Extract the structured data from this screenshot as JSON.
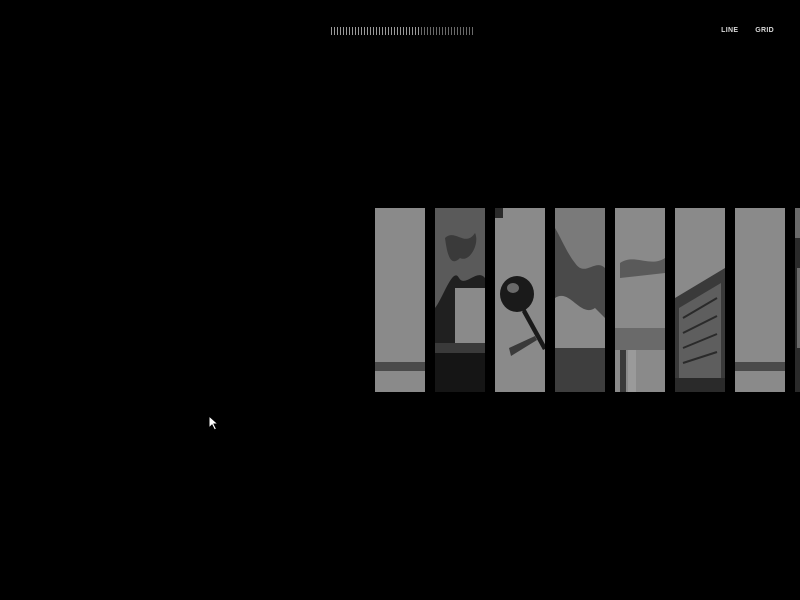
{
  "header": {
    "scrubber_progress": 0.62,
    "view_modes": [
      {
        "label": "LINE"
      },
      {
        "label": "GRID"
      }
    ]
  },
  "gallery": {
    "slices": [
      {
        "icon": "image-thumbnail-plain"
      },
      {
        "icon": "image-thumbnail-foliage"
      },
      {
        "icon": "image-thumbnail-spoon"
      },
      {
        "icon": "image-thumbnail-abstract"
      },
      {
        "icon": "image-thumbnail-sky"
      },
      {
        "icon": "image-thumbnail-building"
      },
      {
        "icon": "image-thumbnail-plain"
      },
      {
        "icon": "image-thumbnail-partial"
      }
    ]
  },
  "colors": {
    "background": "#000000",
    "slice_gray": "#8a8a8a",
    "slice_dark": "#4a4a4a",
    "text": "#d8d8d8"
  }
}
